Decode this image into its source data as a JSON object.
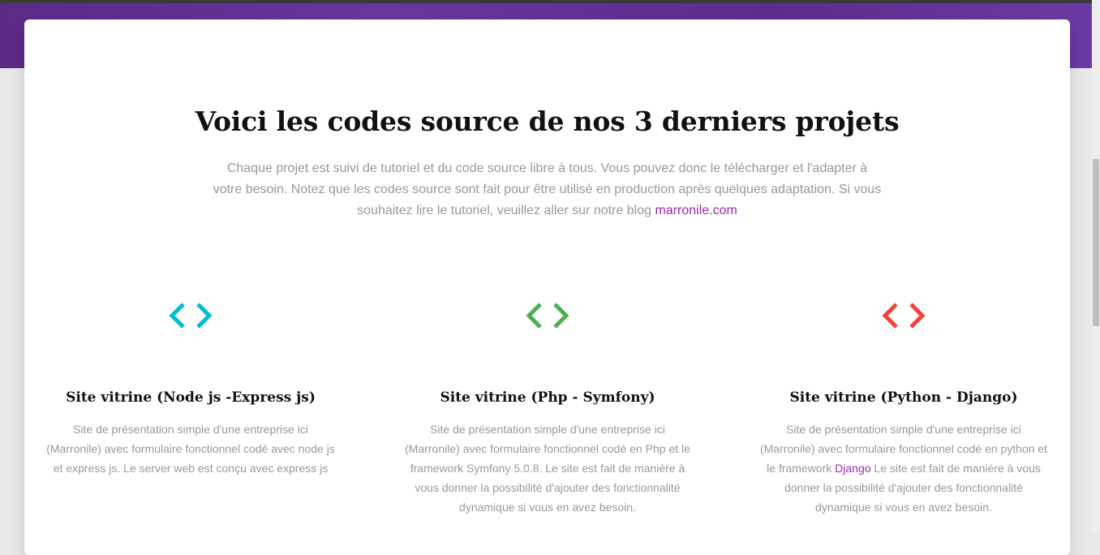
{
  "section": {
    "title": "Voici les codes source de nos 3 derniers projets",
    "description": "Chaque projet est suivi de tutoriel et du code source libre à tous. Vous pouvez donc le télécharger et l'adapter à votre besoin. Notez que les codes source sont fait pour être utilisé en production après quelques adaptation. Si vous souhaitez lire le tutoriel, veuillez aller sur notre blog",
    "blog_link": "marronile.com"
  },
  "features": [
    {
      "icon": "code-icon",
      "icon_color": "#00bcd4",
      "title": "Site vitrine (Node js -Express js)",
      "text": "Site de présentation simple d'une entreprise ici (Marronile) avec formulaire fonctionnel codé avec node js et express js. Le server web est conçu avec express js"
    },
    {
      "icon": "code-icon",
      "icon_color": "#4caf50",
      "title": "Site vitrine (Php - Symfony)",
      "text": "Site de présentation simple d'une entreprise ici (Marronile) avec formulaire fonctionnel codé en Php et le framework Symfony 5.0.8. Le site est fait de manière à vous donner la possibilité d'ajouter des fonctionnalité dynamique si vous en avez besoin."
    },
    {
      "icon": "code-icon",
      "icon_color": "#f44336",
      "title": "Site vitrine (Python - Django)",
      "text_before": "Site de présentation simple d'une entreprise ici (Marronile) avec formulaire fonctionnel codé en python et le framework",
      "link": "Django",
      "text_after": "Le site est fait de manière à vous donner la possibilité d'ajouter des fonctionnalité dynamique si vous en avez besoin."
    }
  ],
  "colors": {
    "accent": "#9c27b0",
    "header_purple": "#5b2a86",
    "muted_text": "#999999"
  }
}
